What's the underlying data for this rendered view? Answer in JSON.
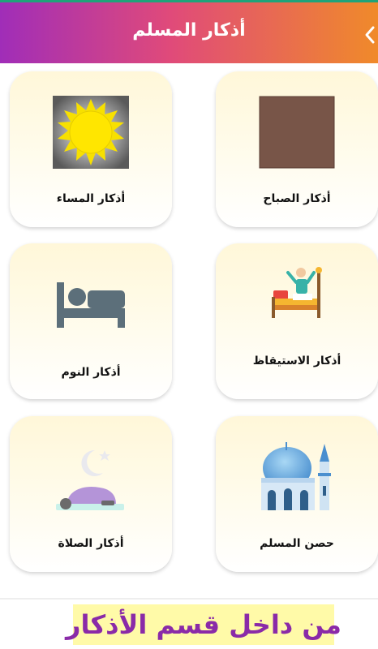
{
  "header": {
    "title": "أذكار المسلم",
    "back_icon": "chevron-left-icon"
  },
  "cards": [
    {
      "label": "أذكار الصباح",
      "icon": "morning-brown-square-icon"
    },
    {
      "label": "أذكار المساء",
      "icon": "sun-icon"
    },
    {
      "label": "أذكار الاستيقاظ",
      "icon": "waking-up-bed-icon"
    },
    {
      "label": "أذكار النوم",
      "icon": "bed-icon"
    },
    {
      "label": "حصن المسلم",
      "icon": "mosque-icon"
    },
    {
      "label": "أذكار الصلاة",
      "icon": "prayer-prostration-icon"
    }
  ],
  "caption": "من داخل قسم الأذكار",
  "colors": {
    "header_gradient_start": "#a02db8",
    "header_gradient_end": "#f08a2a",
    "caption_text": "#8a2aa8",
    "caption_bg": "#fffaa8"
  }
}
